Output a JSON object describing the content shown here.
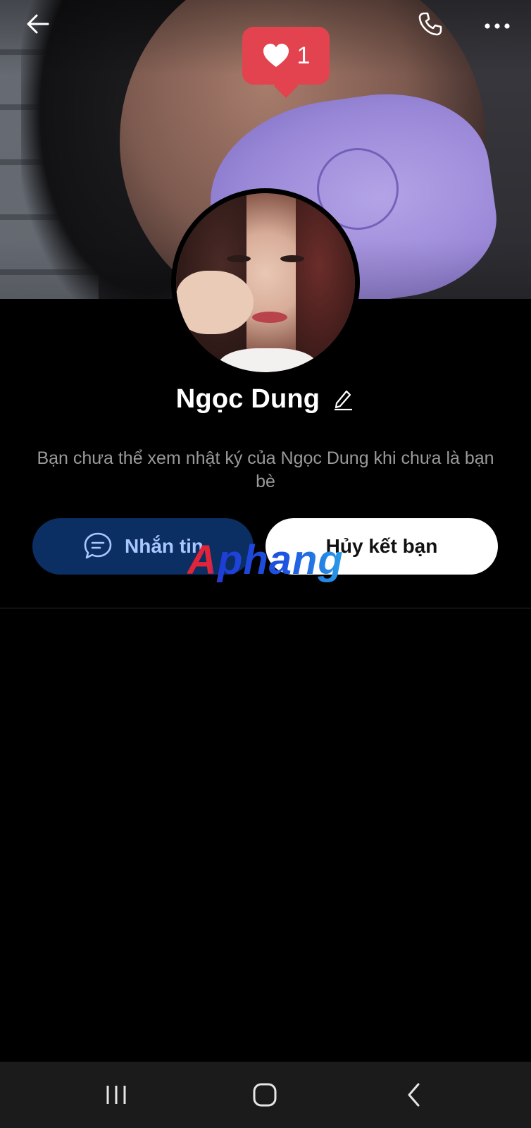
{
  "profile": {
    "name": "Ngọc Dung",
    "like_count": "1",
    "info_message": "Bạn chưa thể xem nhật ký của Ngọc Dung khi chưa là bạn bè"
  },
  "actions": {
    "message_label": "Nhắn tin",
    "unfriend_label": "Hủy kết bạn"
  },
  "watermark": {
    "text": "Aphang"
  },
  "icons": {
    "back": "arrow-left-icon",
    "call": "phone-icon",
    "more": "more-horizontal-icon",
    "like": "heart-icon",
    "edit": "pencil-icon",
    "message": "chat-bubble-icon",
    "nav_recents": "recents-icon",
    "nav_home": "home-icon",
    "nav_back": "chevron-left-icon"
  },
  "colors": {
    "background": "#000000",
    "message_button_bg": "#0b2e63",
    "message_button_text": "#a9c7ff",
    "unfriend_button_bg": "#ffffff",
    "like_badge": "#e2434e",
    "info_text": "#9a9a9a",
    "navbar": "#1b1b1b"
  }
}
